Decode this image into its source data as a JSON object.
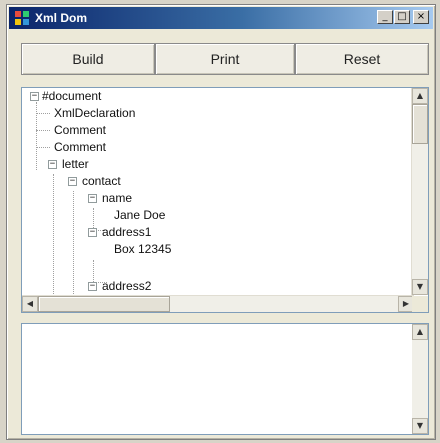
{
  "window": {
    "title": "Xml Dom",
    "minimize_glyph": "_",
    "maximize_glyph": "□",
    "close_glyph": "×"
  },
  "toolbar": {
    "build_label": "Build",
    "print_label": "Print",
    "reset_label": "Reset"
  },
  "tree": {
    "nodes": [
      {
        "label": "#document",
        "toggle": "−"
      },
      {
        "label": "XmlDeclaration",
        "toggle": ""
      },
      {
        "label": "Comment",
        "toggle": ""
      },
      {
        "label": "Comment",
        "toggle": ""
      },
      {
        "label": "letter",
        "toggle": "−"
      },
      {
        "label": "contact",
        "toggle": "−"
      },
      {
        "label": "name",
        "toggle": "−"
      },
      {
        "label": "Jane Doe",
        "toggle": ""
      },
      {
        "label": "address1",
        "toggle": "−"
      },
      {
        "label": "Box 12345",
        "toggle": ""
      },
      {
        "label": "address2",
        "toggle": "−"
      }
    ]
  },
  "text_area": {
    "value": ""
  },
  "icons": {
    "scroll_up": "up-arrow-icon",
    "scroll_down": "down-arrow-icon",
    "scroll_left": "left-arrow-icon",
    "scroll_right": "right-arrow-icon"
  },
  "colors": {
    "title_bar_start": "#0a246a",
    "title_bar_end": "#a6caf0"
  }
}
